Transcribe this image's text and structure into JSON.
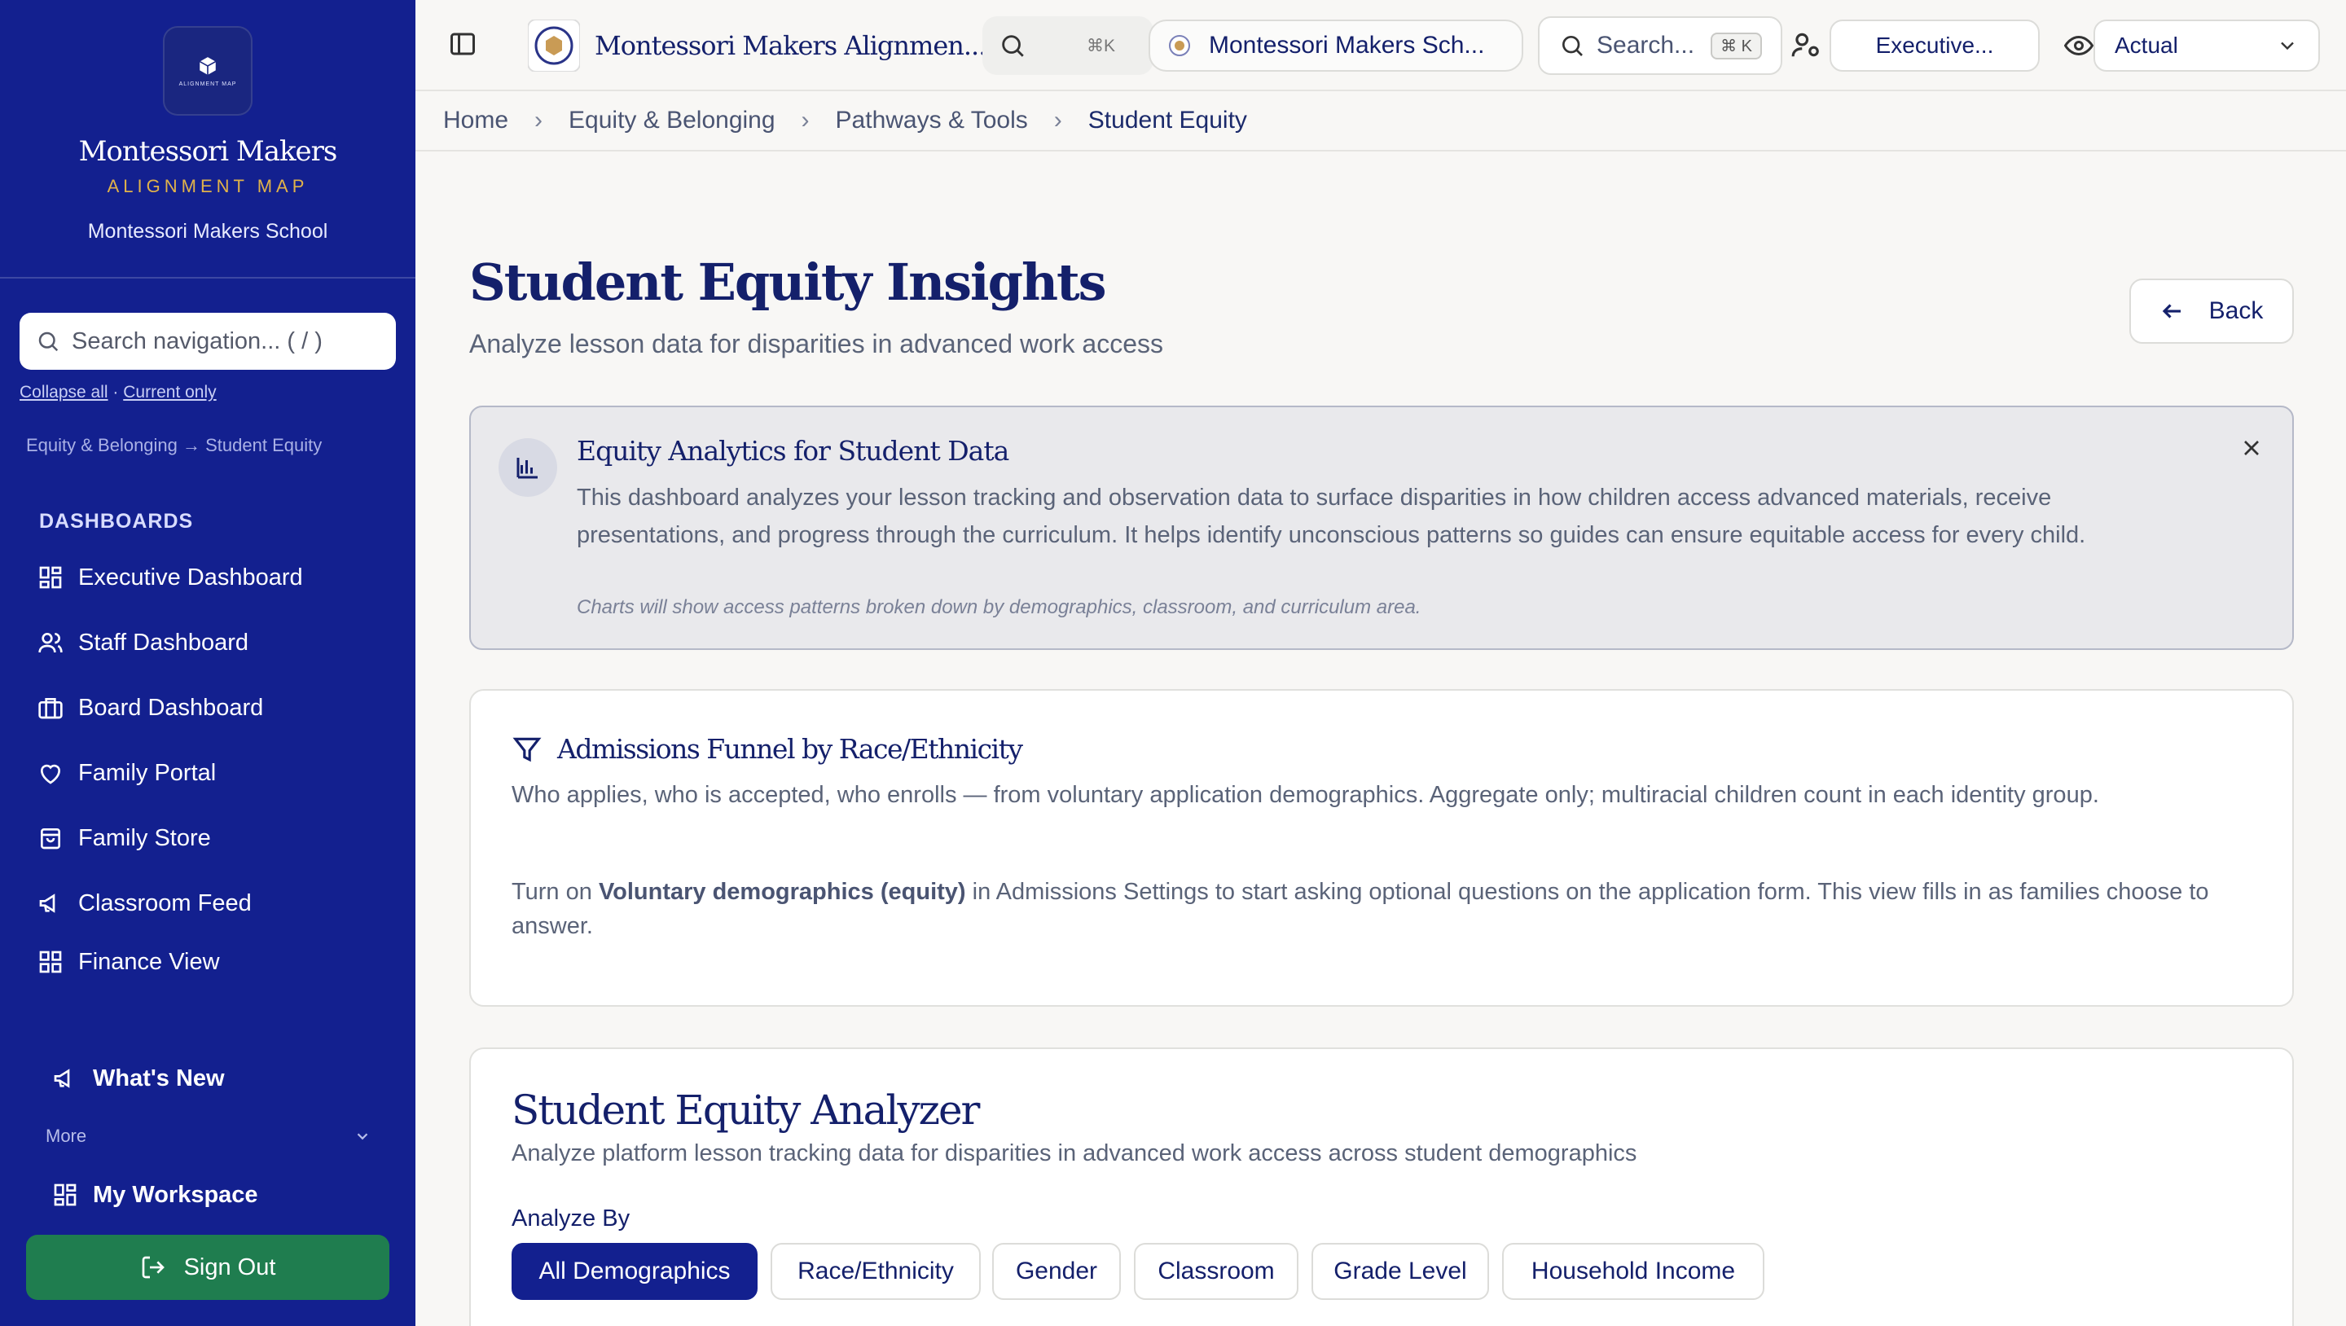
{
  "sidebar": {
    "logo_mini": "ALIGNMENT MAP",
    "brand_name": "Montessori Makers",
    "brand_sub": "ALIGNMENT MAP",
    "school": "Montessori Makers School",
    "search_placeholder": "Search navigation... ( / )",
    "collapse_all": "Collapse all",
    "link_sep": "·",
    "current_only": "Current only",
    "crumb": "Equity & Belonging → Student Equity",
    "section": "DASHBOARDS",
    "items": [
      {
        "label": "Executive Dashboard",
        "icon": "grid-icon"
      },
      {
        "label": "Staff Dashboard",
        "icon": "users-icon"
      },
      {
        "label": "Board Dashboard",
        "icon": "briefcase-icon"
      },
      {
        "label": "Family Portal",
        "icon": "heart-icon"
      },
      {
        "label": "Family Store",
        "icon": "shopping-bag-icon"
      },
      {
        "label": "Classroom Feed",
        "icon": "megaphone-icon"
      },
      {
        "label": "Finance View",
        "icon": "grid-icon"
      }
    ],
    "whats_new": "What's New",
    "more": "More",
    "workspace": "My Workspace",
    "sign_out": "Sign Out"
  },
  "topbar": {
    "app_title": "Montessori Makers Alignmen...",
    "search_kbd": "⌘K",
    "school_switch": "Montessori Makers Sch...",
    "search_label": "Search...",
    "search_kbd2": "⌘ K",
    "role_select": "Executive...",
    "view_select": "Actual"
  },
  "breadcrumb": {
    "home": "Home",
    "equity": "Equity & Belonging",
    "pathways": "Pathways & Tools",
    "current": "Student Equity"
  },
  "page": {
    "title": "Student Equity Insights",
    "subtitle": "Analyze lesson data for disparities in advanced work access",
    "back": "Back"
  },
  "info": {
    "title": "Equity Analytics for Student Data",
    "body": "This dashboard analyzes your lesson tracking and observation data to surface disparities in how children access advanced materials, receive presentations, and progress through the curriculum. It helps identify unconscious patterns so guides can ensure equitable access for every child.",
    "note": "Charts will show access patterns broken down by demographics, classroom, and curriculum area."
  },
  "funnel": {
    "title": "Admissions Funnel by Race/Ethnicity",
    "desc": "Who applies, who is accepted, who enrolls — from voluntary application demographics. Aggregate only; multiracial children count in each identity group.",
    "msg_pre": "Turn on ",
    "msg_bold": "Voluntary demographics (equity)",
    "msg_post": " in Admissions Settings to start asking optional questions on the application form. This view fills in as families choose to answer."
  },
  "analyzer": {
    "title": "Student Equity Analyzer",
    "desc": "Analyze platform lesson tracking data for disparities in advanced work access across student demographics",
    "analyze_by": "Analyze By",
    "options": [
      "All Demographics",
      "Race/Ethnicity",
      "Gender",
      "Classroom",
      "Grade Level",
      "Household Income"
    ],
    "selected": "All Demographics"
  },
  "colors": {
    "sidebar": "#13208f",
    "accent_gold": "#e0b24a",
    "sign_out": "#1f7d4f",
    "navy_text": "#14206b"
  }
}
